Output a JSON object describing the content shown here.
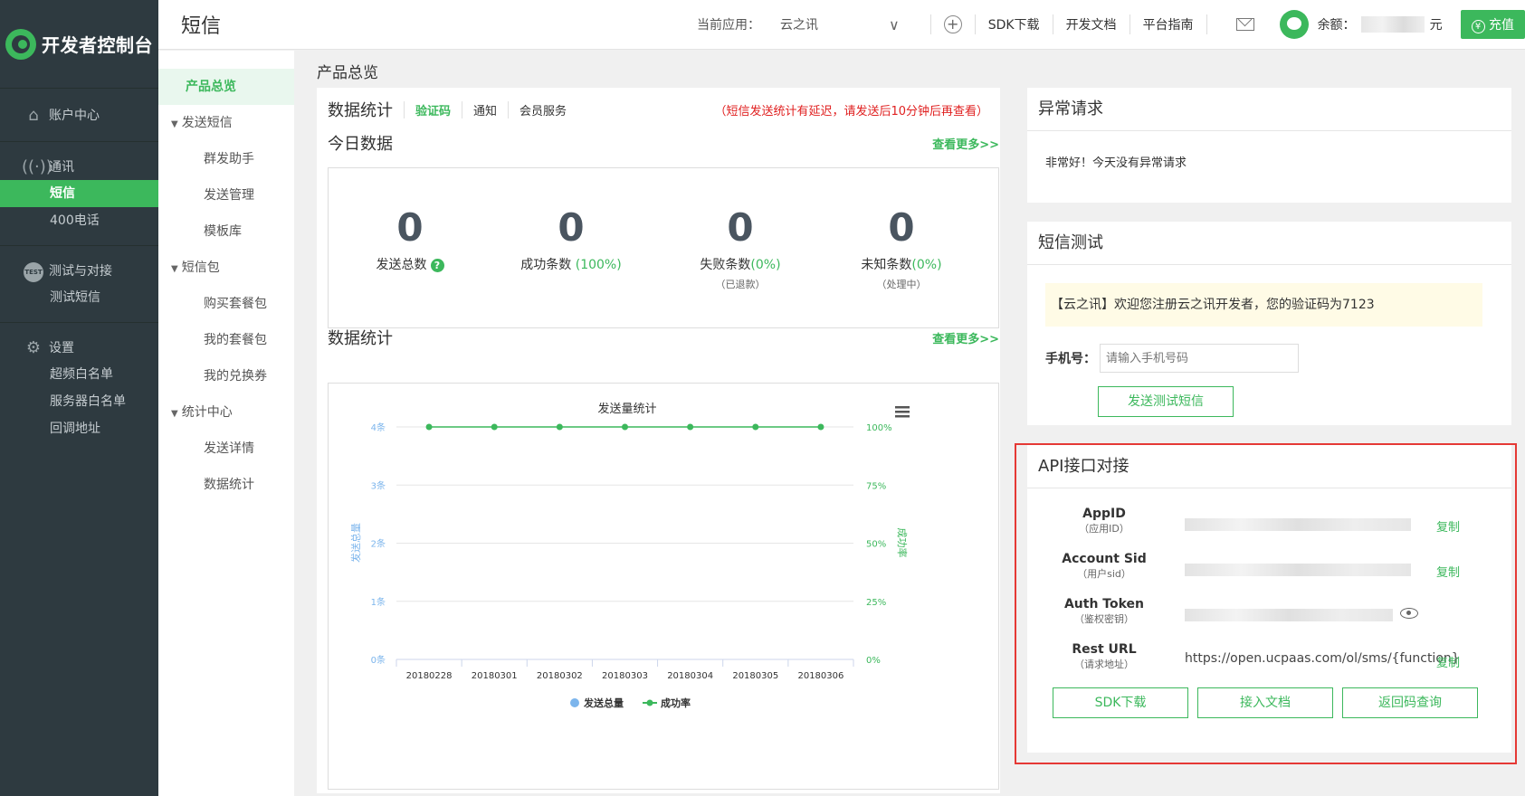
{
  "sidebar": {
    "logo_text": "开发者控制台",
    "groups": [
      {
        "icon": "home-icon",
        "label": "账户中心",
        "items": []
      },
      {
        "icon": "antenna-icon",
        "label": "通讯",
        "items": [
          "短信",
          "400电话"
        ]
      },
      {
        "icon": "test-icon",
        "label": "测试与对接",
        "items": [
          "测试短信"
        ]
      },
      {
        "icon": "gear-icon",
        "label": "设置",
        "items": [
          "超频白名单",
          "服务器白名单",
          "回调地址"
        ]
      }
    ],
    "test_badge": "TEST",
    "active_item": "短信"
  },
  "header": {
    "title": "短信",
    "app_label": "当前应用：",
    "app_name": "云之讯",
    "links": [
      "SDK下载",
      "开发文档",
      "平台指南"
    ],
    "balance_label": "余额：",
    "balance_unit": "元",
    "recharge": "充值",
    "recharge_icon": "¥"
  },
  "subnav": {
    "items": [
      {
        "type": "top",
        "label": "产品总览",
        "active": true
      },
      {
        "type": "group",
        "label": "发送短信"
      },
      {
        "type": "sub",
        "label": "群发助手"
      },
      {
        "type": "sub",
        "label": "发送管理"
      },
      {
        "type": "sub",
        "label": "模板库"
      },
      {
        "type": "group",
        "label": "短信包"
      },
      {
        "type": "sub",
        "label": "购买套餐包"
      },
      {
        "type": "sub",
        "label": "我的套餐包"
      },
      {
        "type": "sub",
        "label": "我的兑换券"
      },
      {
        "type": "group",
        "label": "统计中心"
      },
      {
        "type": "sub",
        "label": "发送详情"
      },
      {
        "type": "sub",
        "label": "数据统计"
      }
    ]
  },
  "breadcrumb": "产品总览",
  "stats": {
    "section_title": "数据统计",
    "tabs": [
      "验证码",
      "通知",
      "会员服务"
    ],
    "active_tab": "验证码",
    "warning": "（短信发送统计有延迟，请发送后10分钟后再查看）",
    "today_title": "今日数据",
    "more": "查看更多>>",
    "metrics": [
      {
        "value": "0",
        "label": "发送总数",
        "pct": "",
        "sub": "",
        "help": "?"
      },
      {
        "value": "0",
        "label": "成功条数",
        "pct": " (100%)",
        "sub": ""
      },
      {
        "value": "0",
        "label": "失败条数",
        "pct": "(0%)",
        "sub": "（已退款）"
      },
      {
        "value": "0",
        "label": "未知条数",
        "pct": "(0%)",
        "sub": "（处理中）"
      }
    ],
    "chart_section_title": "数据统计",
    "chart_more": "查看更多>>"
  },
  "chart_data": {
    "type": "line",
    "title": "发送量统计",
    "categories": [
      "20180228",
      "20180301",
      "20180302",
      "20180303",
      "20180304",
      "20180305",
      "20180306"
    ],
    "left_axis": {
      "label": "发送总量",
      "ticks": [
        "0条",
        "1条",
        "2条",
        "3条",
        "4条"
      ],
      "range": [
        0,
        4
      ],
      "color": "#7cb5ec"
    },
    "right_axis": {
      "label": "成功率",
      "ticks": [
        "0%",
        "25%",
        "50%",
        "75%",
        "100%"
      ],
      "range": [
        0,
        100
      ],
      "color": "#3cb85c"
    },
    "series": [
      {
        "name": "发送总量",
        "type": "bar",
        "axis": "left",
        "values": [
          0,
          0,
          0,
          0,
          0,
          0,
          0
        ],
        "color": "#7cb5ec"
      },
      {
        "name": "成功率",
        "type": "line",
        "axis": "right",
        "values": [
          100,
          100,
          100,
          100,
          100,
          100,
          100
        ],
        "color": "#3cb85c"
      }
    ],
    "legend": "bottom-center",
    "menu_icon": "hamburger-icon"
  },
  "abnormal": {
    "title": "异常请求",
    "message": "非常好！今天没有异常请求"
  },
  "smstest": {
    "title": "短信测试",
    "notice": "【云之讯】欢迎您注册云之讯开发者，您的验证码为7123",
    "phone_label": "手机号：",
    "phone_placeholder": "请输入手机号码",
    "send_button": "发送测试短信"
  },
  "api": {
    "title": "API接口对接",
    "rows": [
      {
        "key": "AppID",
        "key_cn": "（应用ID）",
        "value": "",
        "copy": "复制"
      },
      {
        "key": "Account Sid",
        "key_cn": "（用户sid）",
        "value": "",
        "copy": "复制"
      },
      {
        "key": "Auth Token",
        "key_cn": "（鉴权密钥）",
        "value": "",
        "copy": ""
      },
      {
        "key": "Rest URL",
        "key_cn": "（请求地址）",
        "value": "https://open.ucpaas.com/ol/sms/{function}",
        "copy": "复制"
      }
    ],
    "buttons": [
      "SDK下载",
      "接入文档",
      "返回码查询"
    ]
  },
  "colors": {
    "brand": "#3cb85c",
    "sidebar": "#2e3a40",
    "warning": "#e02020",
    "highlight_frame": "#e53935"
  }
}
